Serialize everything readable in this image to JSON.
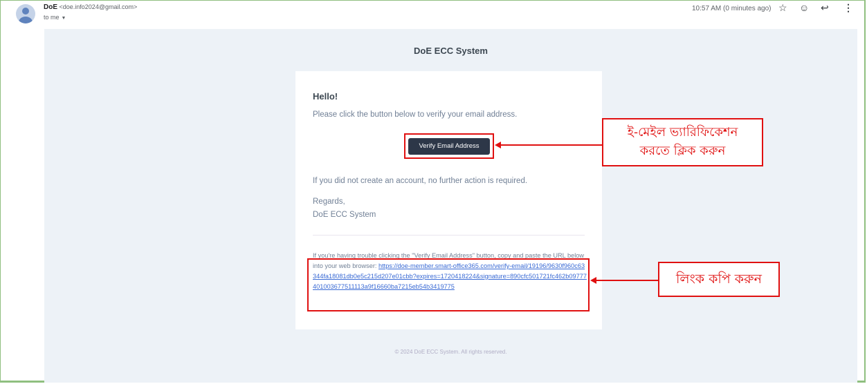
{
  "header": {
    "sender_name": "DoE",
    "sender_email": "<doe.info2024@gmail.com>",
    "recipient": "to me",
    "time": "10:57 AM (0 minutes ago)",
    "icons": [
      "star-icon",
      "emoji-icon",
      "reply-icon",
      "more-vert-icon"
    ]
  },
  "email": {
    "system_title": "DoE ECC System",
    "greeting": "Hello!",
    "intro": "Please click the button below to verify your email address.",
    "button_label": "Verify Email Address",
    "no_action": "If you did not create an account, no further action is required.",
    "regards": "Regards,",
    "signature": "DoE ECC System",
    "trouble_text": "If you're having trouble clicking the \"Verify Email Address\" button, copy and paste the URL below into your web browser: ",
    "link": "https://doe-member.smart-office365.com/verify-email/19196/9630f960c63344fa18081db0e5c215d207e01cbb?expires=1720418224&signature=890cfc501721fc462b09777401003677511113a9f16660ba7215eb54b3419775",
    "footer": "© 2024 DoE ECC System. All rights reserved."
  },
  "annotations": {
    "verify_note_line1": "ই-মেইল ভ্যারিফিকেশন",
    "verify_note_line2": "করতে ক্লিক করুন",
    "link_note": "লিংক কপি করুন",
    "color": "#e01010"
  }
}
